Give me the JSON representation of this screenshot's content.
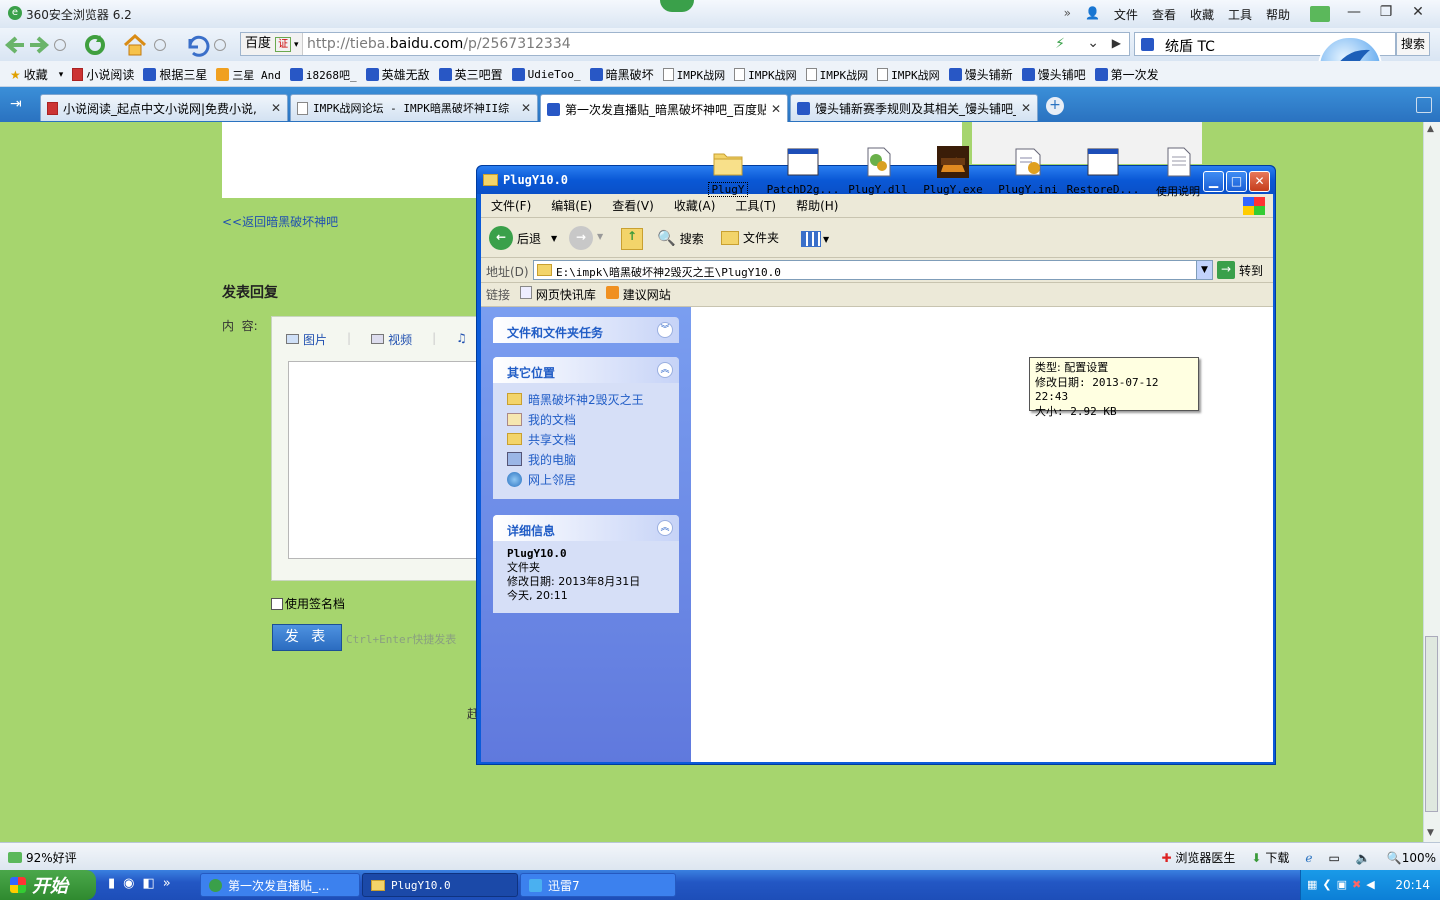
{
  "browser": {
    "title": "360安全浏览器 6.2",
    "menu": [
      "文件",
      "查看",
      "收藏",
      "工具",
      "帮助"
    ],
    "win_controls": [
      "—",
      "❐",
      "✕"
    ],
    "address": {
      "engine": "百度",
      "badge": "证",
      "url_prefix": "http://tieba.",
      "url_domain": "baidu.com",
      "url_path": "/p/2567312334"
    },
    "search": {
      "value": "统盾 TC",
      "button": "搜索"
    }
  },
  "bookmarks": [
    "收藏",
    "小说阅读",
    "根据三星",
    "三星 And",
    "i8268吧_",
    "英雄无敌",
    "英三吧置",
    "UdieToo_",
    "暗黑破坏",
    "IMPK战网",
    "IMPK战网",
    "IMPK战网",
    "IMPK战网",
    "馒头铺新",
    "馒头铺吧",
    "第一次发"
  ],
  "tabs": [
    {
      "label": "小说阅读_起点中文小说网|免费小说,"
    },
    {
      "label": "IMPK战网论坛 - IMPK暗黑破坏神II综"
    },
    {
      "label": "第一次发直播贴_暗黑破坏神吧_百度贴"
    },
    {
      "label": "馒头铺新赛季规则及其相关_馒头铺吧_"
    }
  ],
  "page": {
    "back_link": "<<返回暗黑破坏神吧",
    "reply_heading": "发表回复",
    "content_label": "内  容:",
    "editor_tools": [
      "图片",
      "视频"
    ],
    "signature": "使用签名档",
    "post_button": "发 表",
    "post_hint": "Ctrl+Enter快捷发表",
    "fragment": "赶"
  },
  "status": {
    "rating": "92%好评",
    "doctor": "浏览器医生",
    "download": "下载",
    "zoom": "100%"
  },
  "taskbar": {
    "start": "开始",
    "items": [
      "第一次发直播贴_...",
      "PlugY10.0",
      "迅雷7"
    ],
    "clock": "20:14"
  },
  "explorer": {
    "title": "PlugY10.0",
    "menu": [
      "文件(F)",
      "编辑(E)",
      "查看(V)",
      "收藏(A)",
      "工具(T)",
      "帮助(H)"
    ],
    "toolbar": {
      "back": "后退",
      "search": "搜索",
      "folders": "文件夹"
    },
    "address_label": "地址(D)",
    "address_value": "E:\\impk\\暗黑破坏神2毁灭之王\\PlugY10.0",
    "go": "转到",
    "links_label": "链接",
    "links": [
      "网页快讯库",
      "建议网站"
    ],
    "tasks_heading": "文件和文件夹任务",
    "places_heading": "其它位置",
    "places": [
      "暗黑破坏神2毁灭之王",
      "我的文档",
      "共享文档",
      "我的电脑",
      "网上邻居"
    ],
    "details_heading": "详细信息",
    "details": {
      "name": "PlugY10.0",
      "type": "文件夹",
      "modified": "修改日期: 2013年8月31日",
      "time": "今天, 20:11"
    },
    "files": [
      "PlugY",
      "PatchD2g...",
      "PlugY.dll",
      "PlugY.exe",
      "PlugY.ini",
      "RestoreD...",
      "使用说明"
    ],
    "tooltip": {
      "type": "类型: 配置设置",
      "modified": "修改日期: 2013-07-12 22:43",
      "size": "大小: 2.92 KB"
    }
  }
}
